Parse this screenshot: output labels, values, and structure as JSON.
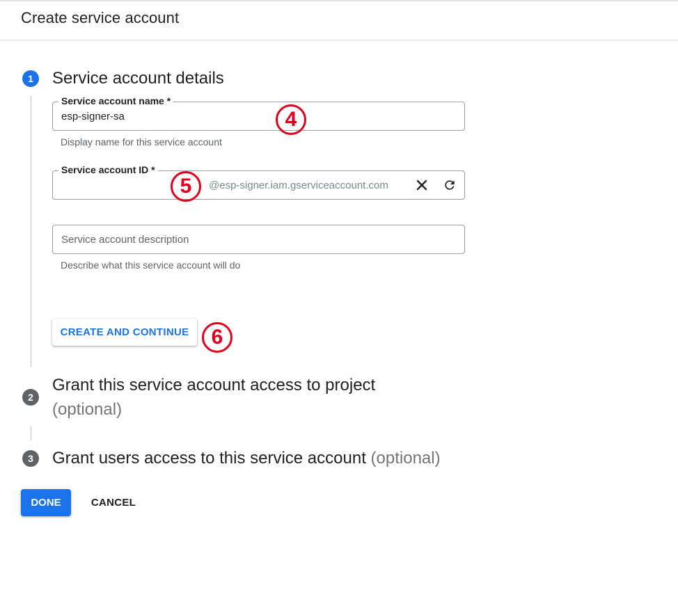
{
  "header": {
    "title": "Create service account"
  },
  "steps": [
    {
      "number": "1",
      "title": "Service account details",
      "optional": ""
    },
    {
      "number": "2",
      "title": "Grant this service account access to project",
      "optional": "(optional)"
    },
    {
      "number": "3",
      "title": "Grant users access to this service account",
      "optional": "(optional)"
    }
  ],
  "form": {
    "name": {
      "label": "Service account name *",
      "value": "esp-signer-sa",
      "hint": "Display name for this service account"
    },
    "account_id": {
      "label": "Service account ID *",
      "value": "",
      "suffix": "@esp-signer.iam.gserviceaccount.com",
      "clear_icon": "close-icon",
      "refresh_icon": "refresh-icon"
    },
    "description": {
      "placeholder": "Service account description",
      "value": "",
      "hint": "Describe what this service account will do"
    }
  },
  "buttons": {
    "create_continue": "CREATE AND CONTINUE",
    "done": "DONE",
    "cancel": "CANCEL"
  },
  "annotations": [
    "4",
    "5",
    "6"
  ],
  "colors": {
    "primary": "#1a73e8",
    "step_inactive": "#5f6368",
    "annotation": "#e3001b"
  }
}
